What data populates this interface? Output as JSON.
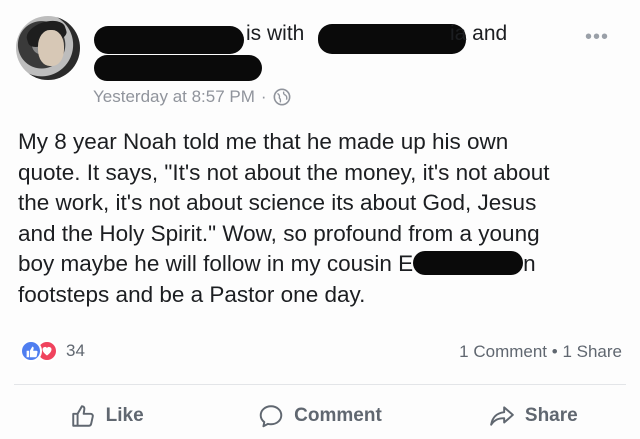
{
  "post": {
    "header": {
      "with_text": "is with",
      "and_text": "ia and",
      "timestamp": "Yesterday at 8:57 PM",
      "separator": "·",
      "privacy_icon": "globe-icon",
      "more_label": "•••"
    },
    "message": {
      "lines": [
        "My 8 year Noah told me that he made up his own",
        "quote. It says, \"It's not about the money, it's not about",
        "the work, it's not about science its about God, Jesus",
        "and the Holy Spirit.\" Wow, so profound from a young",
        "boy maybe he will follow in my cousin E",
        "n",
        "footsteps and be a Pastor one day."
      ]
    },
    "reactions": {
      "icons": [
        "like-icon",
        "love-icon"
      ],
      "count": "34",
      "comments": "1 Comment",
      "dot": "•",
      "shares": "1 Share"
    },
    "actions": [
      {
        "label": "Like",
        "icon": "thumbs-up-icon"
      },
      {
        "label": "Comment",
        "icon": "comment-icon"
      },
      {
        "label": "Share",
        "icon": "share-arrow-icon"
      }
    ],
    "colors": {
      "like_blue": "#4f7ef0",
      "love_red": "#f0435d",
      "meta_gray": "#90949c",
      "action_gray": "#606770"
    }
  }
}
